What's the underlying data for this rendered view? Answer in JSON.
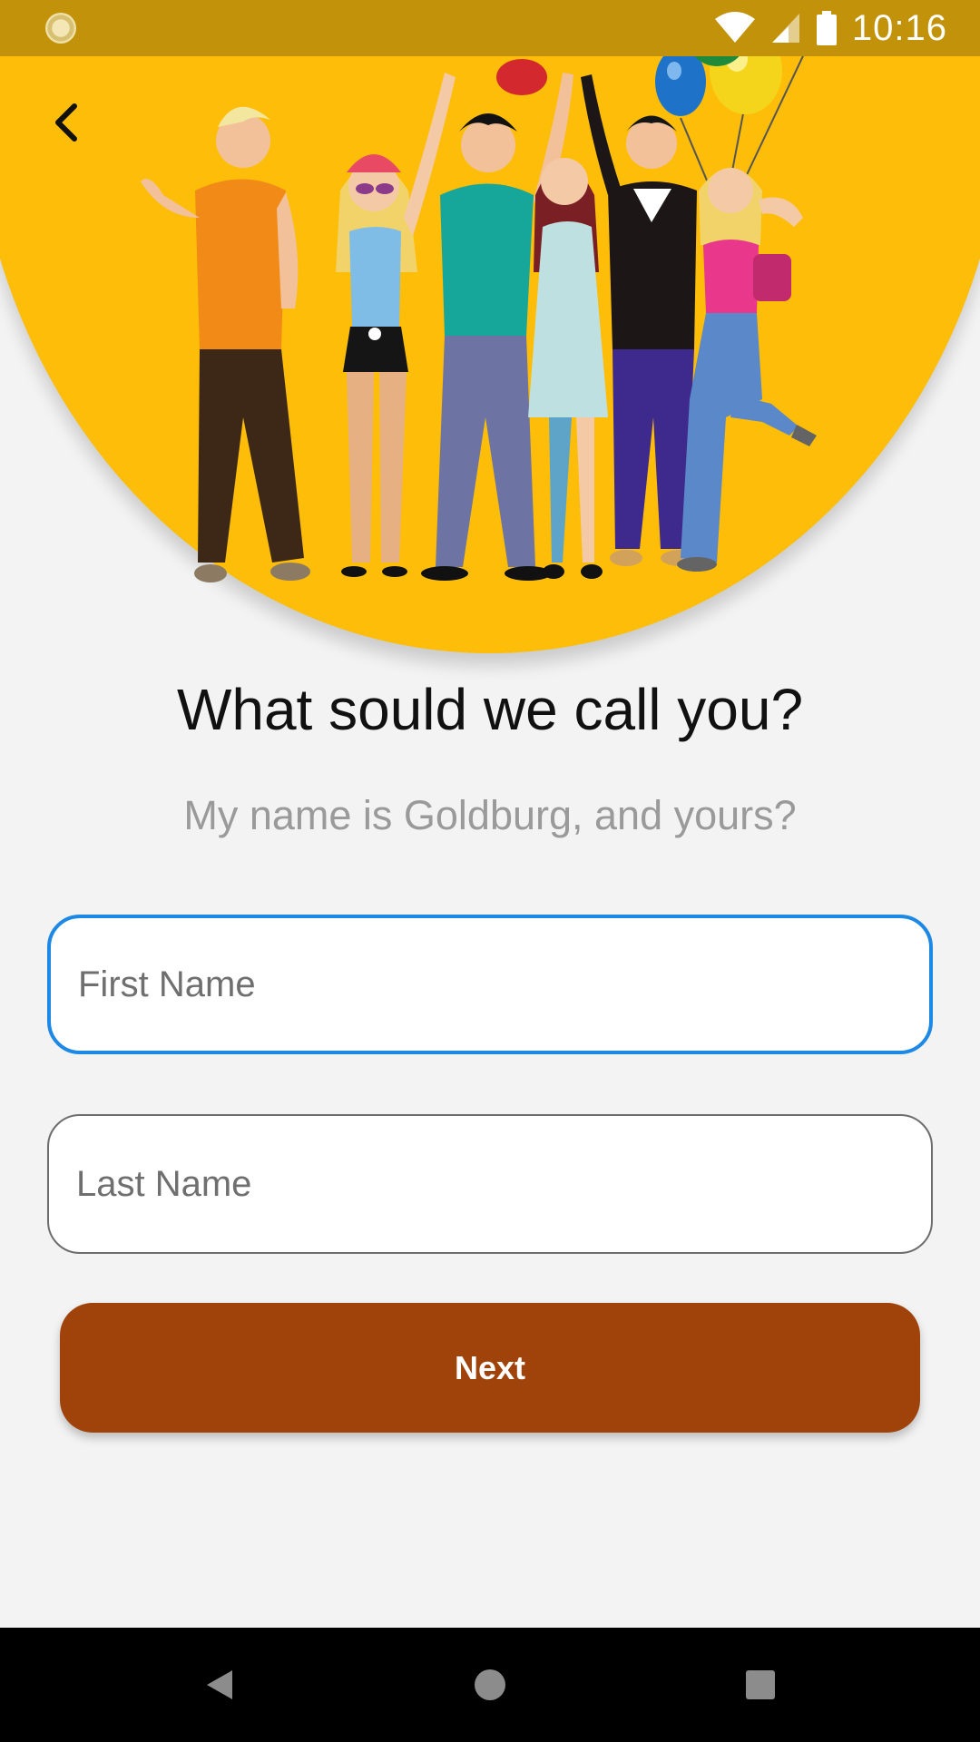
{
  "status_bar": {
    "time": "10:16",
    "icons": [
      "app-notification-icon",
      "wifi-icon",
      "signal-icon",
      "battery-icon"
    ]
  },
  "header": {
    "back_icon": "chevron-left-icon",
    "illustration": "group-of-friends-with-balloons"
  },
  "main": {
    "title": "What sould we call you?",
    "subtitle": "My name is Goldburg, and yours?",
    "first_name": {
      "value": "",
      "placeholder": "First Name",
      "focused": true
    },
    "last_name": {
      "value": "",
      "placeholder": "Last Name",
      "focused": false
    },
    "next_label": "Next"
  },
  "nav_bar": {
    "icons": [
      "back-triangle-icon",
      "home-circle-icon",
      "recents-square-icon"
    ]
  },
  "colors": {
    "status_bar": "#c2930a",
    "header_yellow": "#fdbd08",
    "background": "#f3f3f3",
    "focus_border": "#1e88e5",
    "button": "#a0430b"
  }
}
